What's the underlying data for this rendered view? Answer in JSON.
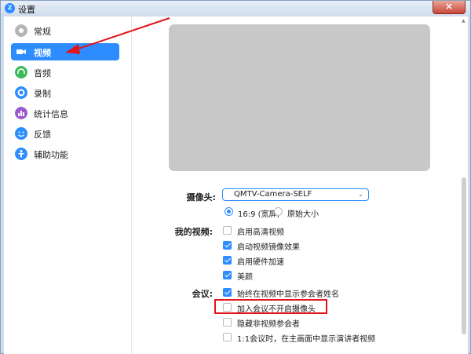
{
  "window": {
    "title": "设置",
    "app_icon": "zoom-logo",
    "close_symbol": "×"
  },
  "sidebar": {
    "items": [
      {
        "label": "常规",
        "icon": "gear-icon",
        "icon_color": "#9a9a9a",
        "active": false
      },
      {
        "label": "视频",
        "icon": "camera-icon",
        "icon_color": "#2d8cff",
        "active": true
      },
      {
        "label": "音频",
        "icon": "headphones-icon",
        "icon_color": "#3db85a",
        "active": false
      },
      {
        "label": "录制",
        "icon": "record-icon",
        "icon_color": "#2d8cff",
        "active": false
      },
      {
        "label": "统计信息",
        "icon": "stats-icon",
        "icon_color": "#9b59d0",
        "active": false
      },
      {
        "label": "反馈",
        "icon": "smile-icon",
        "icon_color": "#2d8cff",
        "active": false
      },
      {
        "label": "辅助功能",
        "icon": "accessibility-icon",
        "icon_color": "#2d8cff",
        "active": false
      }
    ]
  },
  "video": {
    "camera_label": "摄像头:",
    "camera_selected": "QMTV-Camera-SELF",
    "aspect_options": [
      {
        "label": "16:9 (宽屏)",
        "selected": true
      },
      {
        "label": "原始大小",
        "selected": false
      }
    ],
    "my_video_label": "我的视频:",
    "my_video_options": [
      {
        "label": "启用高清视频",
        "checked": false
      },
      {
        "label": "启动视频镜像效果",
        "checked": true
      },
      {
        "label": "启用硬件加速",
        "checked": true
      },
      {
        "label": "美颜",
        "checked": true
      }
    ],
    "meeting_label": "会议:",
    "meeting_options": [
      {
        "label": "始终在视频中显示参会者姓名",
        "checked": true
      },
      {
        "label": "加入会议不开启摄像头",
        "checked": false
      },
      {
        "label": "隐藏非视频参会者",
        "checked": false
      },
      {
        "label": "1:1会议时，在主画面中显示演讲者视频",
        "checked": false
      }
    ]
  },
  "colors": {
    "accent": "#2d8cff",
    "highlight": "#e0161c",
    "preview_bg": "#c8c8c8"
  }
}
